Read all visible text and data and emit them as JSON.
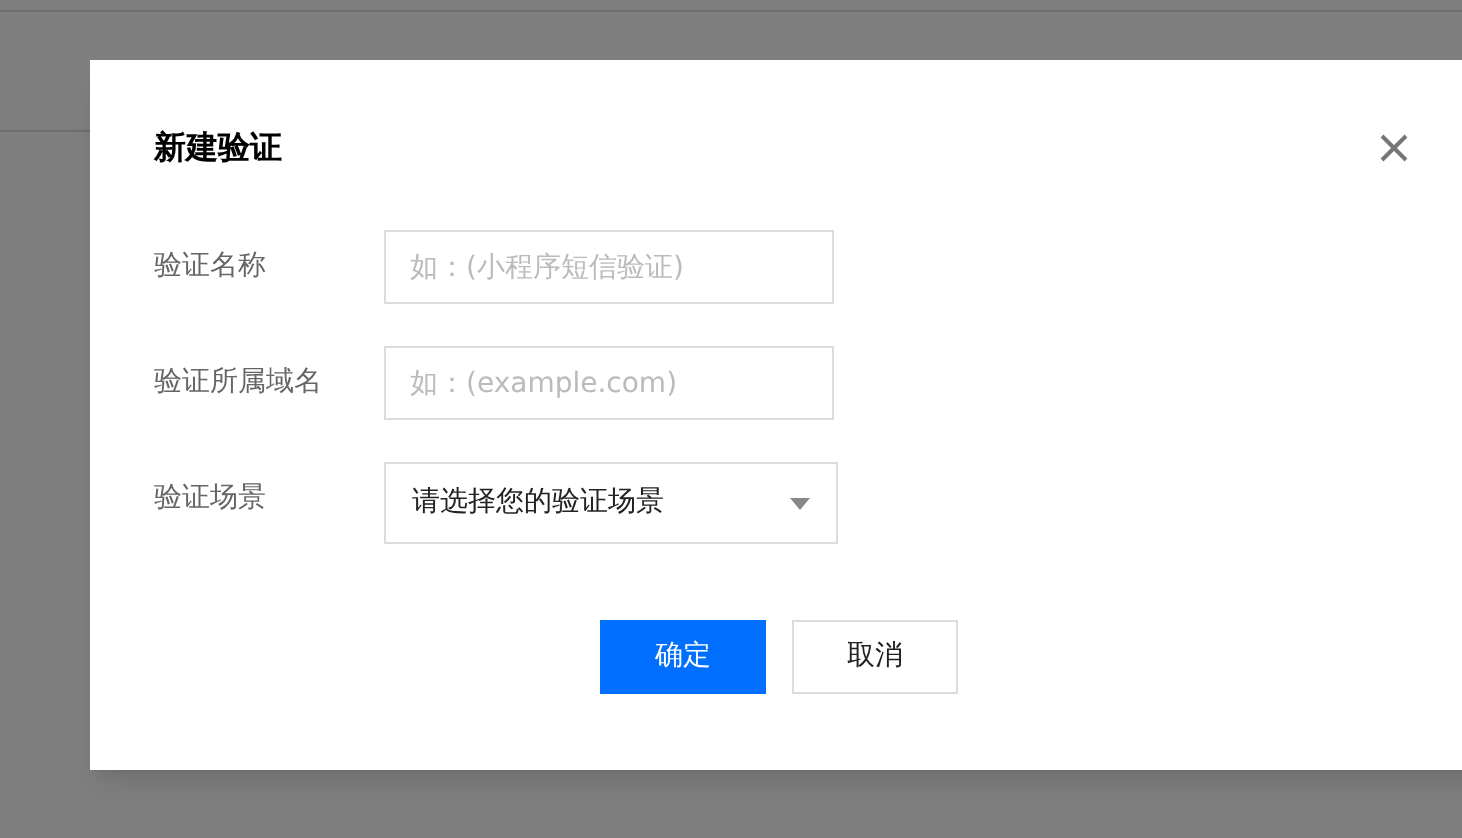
{
  "dialog": {
    "title": "新建验证",
    "fields": [
      {
        "kind": "input",
        "label": "验证名称",
        "placeholder": "如：(小程序短信验证)"
      },
      {
        "kind": "input",
        "label": "验证所属域名",
        "placeholder": "如：(example.com)"
      },
      {
        "kind": "select",
        "label": "验证场景",
        "value": "请选择您的验证场景"
      }
    ],
    "buttons": [
      {
        "label": "确定",
        "primary": true
      },
      {
        "label": "取消",
        "primary": false
      }
    ]
  }
}
